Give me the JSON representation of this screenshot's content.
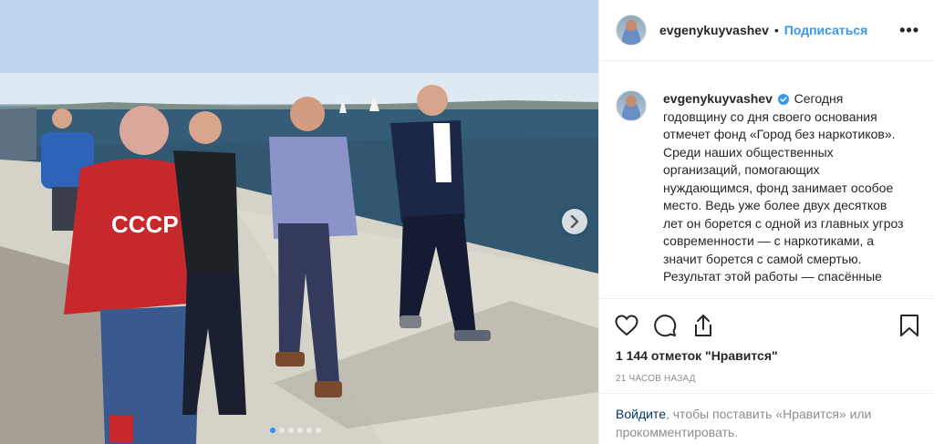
{
  "post": {
    "username": "evgenykuyvashev",
    "follow_label": "Подписаться",
    "more_label": "•••",
    "caption": "Сегодня годовщину со дня своего основания отмечет фонд «Город без наркотиков». Среди наших общественных организаций, помогающих нуждающимся, фонд занимает особое место. Ведь уже более двух десятков лет он борется с одной из главных угроз современности — с наркотиками, а значит борется с самой смертью. Результат этой работы — спасённые",
    "likes_text": "1 144 отметок \"Нравится\"",
    "time_text": "21 часов назад",
    "login_link": "Войдите",
    "login_rest": ", чтобы поставить «Нравится» или прокомментировать."
  },
  "carousel": {
    "slide_count": 6,
    "active_index": 0
  },
  "icons": {
    "like": "heart-icon",
    "comment": "comment-icon",
    "share": "share-icon",
    "save": "bookmark-icon",
    "next": "chevron-right-icon",
    "verified": "verified-badge-icon"
  },
  "colors": {
    "accent": "#3897f0",
    "link": "#00376b",
    "muted": "#8e8e8e",
    "text": "#262626"
  }
}
